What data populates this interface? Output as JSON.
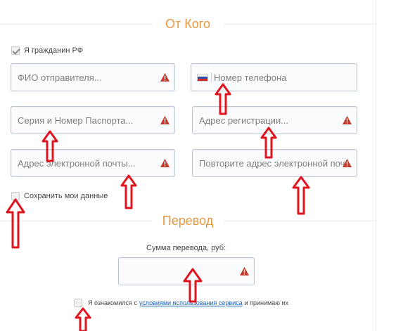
{
  "from_section": {
    "title": "От Кого",
    "citizen_checkbox": {
      "label": "Я гражданин РФ",
      "checked": true
    },
    "fields": {
      "fio": {
        "placeholder": "ФИО отправителя..."
      },
      "phone": {
        "placeholder": "Номер телефона",
        "flag": "russia-flag-icon"
      },
      "passport": {
        "placeholder": "Серия и Номер Паспорта..."
      },
      "address": {
        "placeholder": "Адрес регистрации..."
      },
      "email": {
        "placeholder": "Адрес электронной почты..."
      },
      "email_repeat": {
        "placeholder": "Повторите адрес электронной почты"
      }
    },
    "save_checkbox": {
      "label": "Сохранить мои данные",
      "checked": false
    }
  },
  "transfer_section": {
    "title": "Перевод",
    "amount_label": "Сумма перевода, руб:",
    "amount_field": {
      "placeholder": ""
    }
  },
  "terms": {
    "prefix": "Я ознакомился с",
    "link": "условиями использования сервиса",
    "suffix": "и принимаю их",
    "checked": false
  },
  "colors": {
    "accent": "#e8983e",
    "field_border": "#b9c7d9",
    "warning": "#c0392b",
    "annotation_arrow": "#e0141e",
    "link": "#1a5fb4"
  },
  "icons": {
    "warning": "warning-triangle-icon",
    "annotation": "red-up-arrow-icon"
  }
}
